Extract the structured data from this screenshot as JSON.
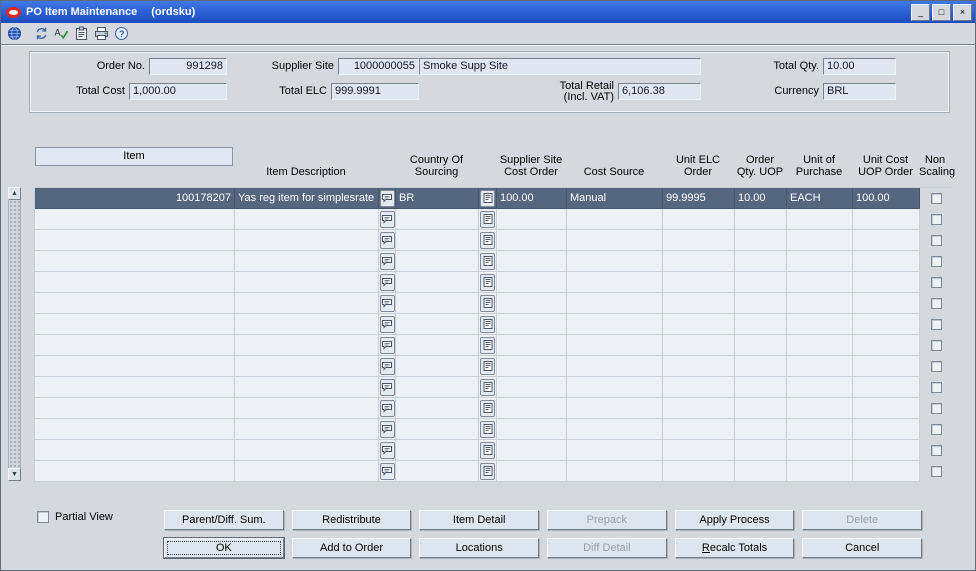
{
  "window": {
    "title": "PO Item Maintenance",
    "code": "(ordsku)",
    "minimize_glyph": "_",
    "maximize_glyph": "□",
    "close_glyph": "×"
  },
  "toolbar": {
    "icons": [
      "globe-icon",
      "refresh-icon",
      "spellcheck-icon",
      "clipboard-icon",
      "printer-icon",
      "help-icon"
    ]
  },
  "header": {
    "order_no_label": "Order No.",
    "order_no": "991298",
    "supplier_site_label": "Supplier Site",
    "supplier_site_id": "1000000055",
    "supplier_site_name": "Smoke Supp Site",
    "total_qty_label": "Total Qty.",
    "total_qty": "10.00",
    "total_cost_label": "Total Cost",
    "total_cost": "1,000.00",
    "total_elc_label": "Total ELC",
    "total_elc": "999.9991",
    "total_retail_label": "Total Retail\n(Incl. VAT)",
    "total_retail": "6,106.38",
    "currency_label": "Currency",
    "currency": "BRL"
  },
  "table": {
    "columns": [
      "Item",
      "Item Description",
      "Country Of\nSourcing",
      "Supplier Site\nCost Order",
      "Cost Source",
      "Unit ELC\nOrder",
      "Order\nQty. UOP",
      "Unit of\nPurchase",
      "Unit Cost\nUOP Order",
      "Non\nScaling"
    ],
    "row": {
      "item": "100178207",
      "item_description": "Yas reg item for simplesrate",
      "country_of_sourcing": "BR",
      "supplier_site_cost_order": "100.00",
      "cost_source": "Manual",
      "unit_elc_order": "99.9995",
      "order_qty_uop": "10.00",
      "unit_of_purchase": "EACH",
      "unit_cost_uop_order": "100.00",
      "non_scaling": false
    },
    "empty_row_count": 13
  },
  "footer": {
    "partial_view_label": "Partial View",
    "buttons_row1": [
      {
        "label": "Parent/Diff. Sum.",
        "enabled": true
      },
      {
        "label": "Redistribute",
        "enabled": true
      },
      {
        "label": "Item Detail",
        "enabled": true
      },
      {
        "label": "Prepack",
        "enabled": false
      },
      {
        "label": "Apply Process",
        "enabled": true
      },
      {
        "label": "Delete",
        "enabled": false
      }
    ],
    "buttons_row2": [
      {
        "label": "OK",
        "enabled": true,
        "focused": true
      },
      {
        "label": "Add to Order",
        "enabled": true
      },
      {
        "label": "Locations",
        "enabled": true
      },
      {
        "label": "Diff Detail",
        "enabled": false
      },
      {
        "label": "Recalc Totals",
        "enabled": true,
        "underline": 0
      },
      {
        "label": "Cancel",
        "enabled": true
      }
    ]
  }
}
